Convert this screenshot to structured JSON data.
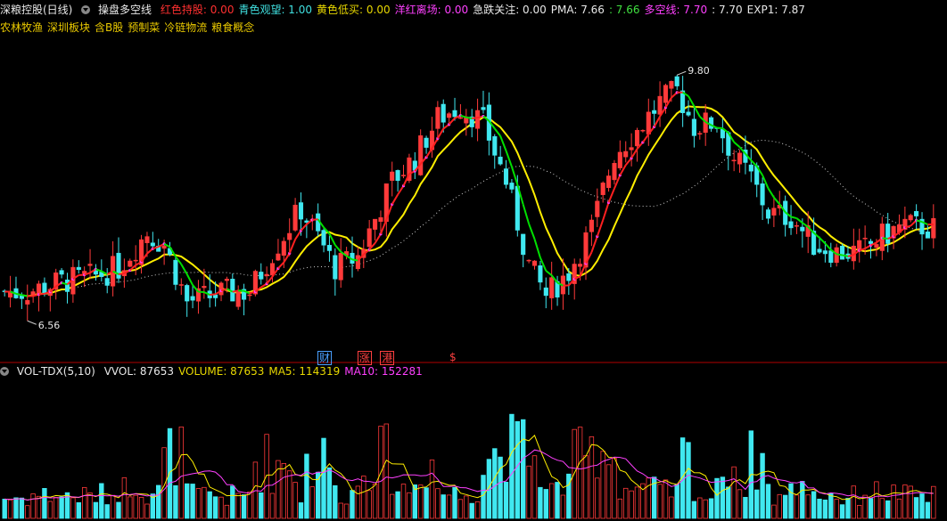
{
  "header": {
    "stock_title": "深粮控股(日线)",
    "indicator_name": "操盘多空线",
    "items": [
      {
        "label": "红色持股:",
        "value": "0.00",
        "color": "#ff3030"
      },
      {
        "label": "青色观望:",
        "value": "1.00",
        "color": "#40e0e0"
      },
      {
        "label": "黄色低买:",
        "value": "0.00",
        "color": "#e8d800"
      },
      {
        "label": "洋红离场:",
        "value": "0.00",
        "color": "#ff40ff"
      },
      {
        "label": "急跌关注:",
        "value": "0.00",
        "color": "#e8e8e8"
      },
      {
        "label": "PMA:",
        "value": "7.66",
        "color": "#e8e8e8"
      },
      {
        "label": ":",
        "value": "7.66",
        "color": "#40e040"
      },
      {
        "label": "多空线:",
        "value": "7.70",
        "color": "#ff40ff"
      },
      {
        "label": ":",
        "value": "7.70",
        "color": "#e8e8e8"
      },
      {
        "label": "EXP1:",
        "value": "7.87",
        "color": "#e8e8e8"
      }
    ]
  },
  "concept_tags": [
    "农林牧渔",
    "深圳板块",
    "含B股",
    "预制菜",
    "冷链物流",
    "粮食概念"
  ],
  "annotations": {
    "high_label": "9.80",
    "low_label": "6.56"
  },
  "markers": [
    {
      "text": "财",
      "color": "#4aa0ff",
      "border": "#4aa0ff",
      "index": 56
    },
    {
      "text": "涨",
      "color": "#ff4040",
      "border": "#ff4040",
      "index": 63
    },
    {
      "text": "港",
      "color": "#ff4040",
      "border": "#ff4040",
      "index": 67
    },
    {
      "text": "$",
      "color": "#ff4040",
      "border": "none",
      "index": 79
    }
  ],
  "volume_header": {
    "name": "VOL-TDX(5,10)",
    "items": [
      {
        "label": "VVOL:",
        "value": "87653",
        "color": "#e8e8e8"
      },
      {
        "label": "VOLUME:",
        "value": "87653",
        "color": "#e8d800"
      },
      {
        "label": "MA5:",
        "value": "114319",
        "color": "#e8d800"
      },
      {
        "label": "MA10:",
        "value": "152281",
        "color": "#ff40ff"
      }
    ]
  },
  "colors": {
    "up": "#ff3a3a",
    "down": "#40e8f0",
    "ma_fast": "#ffee00",
    "ma_green": "#00e000",
    "ma_red": "#ff2020",
    "dotted": "#cccccc",
    "separator": "#b00000"
  },
  "chart_data": {
    "type": "candlestick",
    "price_range": [
      6.2,
      10.1
    ],
    "volume_range": [
      0,
      400000
    ],
    "candles": []
  }
}
